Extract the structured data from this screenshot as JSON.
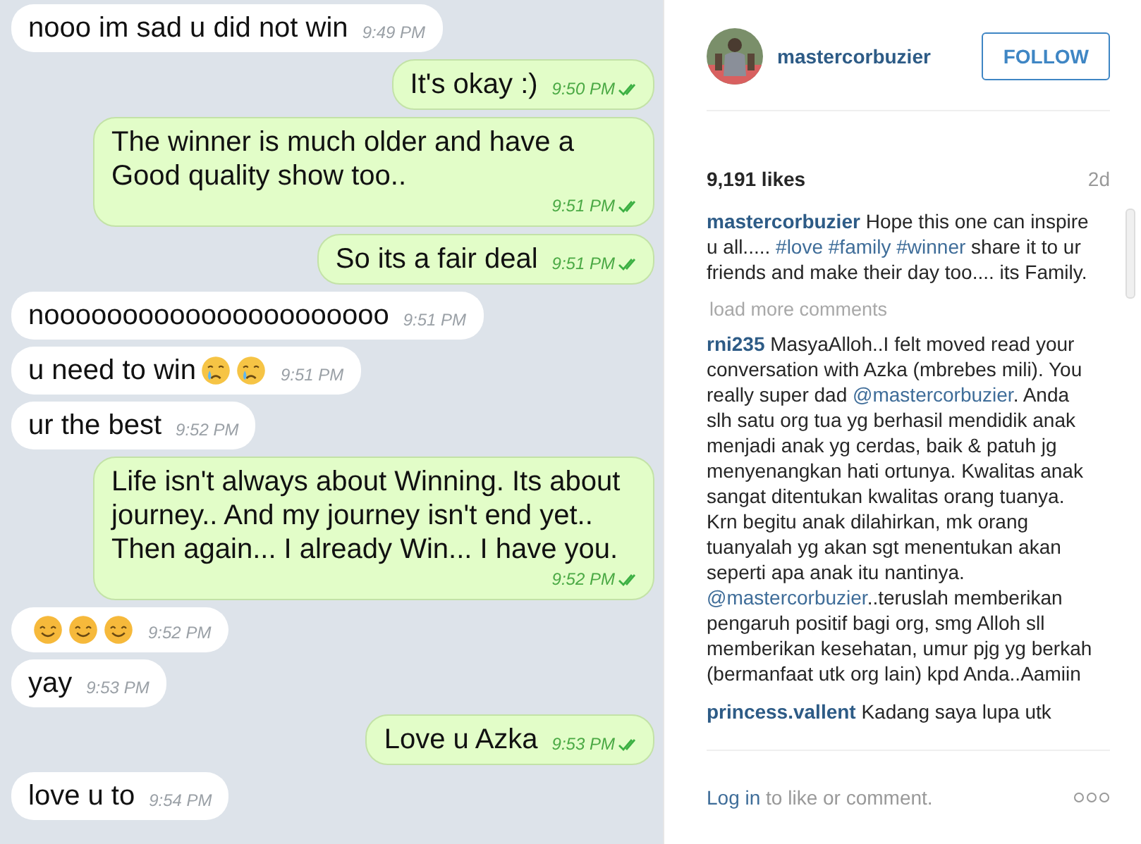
{
  "chat": {
    "messages": [
      {
        "kind": "in",
        "text": "nooo im sad u did not win",
        "time": "9:49 PM"
      },
      {
        "kind": "out",
        "text": "It's okay :)",
        "time": "9:50 PM",
        "read": true
      },
      {
        "kind": "out",
        "text": "The winner is much older and have a Good quality show too..",
        "time": "9:51 PM",
        "read": true
      },
      {
        "kind": "out",
        "text": "So its a fair deal",
        "time": "9:51 PM",
        "read": true
      },
      {
        "kind": "in",
        "text": "noooooooooooooooooooooo",
        "time": "9:51 PM"
      },
      {
        "kind": "in",
        "text": "u need to win",
        "icons": [
          {
            "kind": "crying"
          },
          {
            "kind": "crying"
          }
        ],
        "time": "9:51 PM"
      },
      {
        "kind": "in",
        "text": "ur the best",
        "time": "9:52 PM"
      },
      {
        "kind": "out",
        "text": "Life isn't always about Winning. Its about journey.. And my journey isn't end yet.. Then again... I already Win... I have you.",
        "time": "9:52 PM",
        "read": true
      },
      {
        "kind": "in",
        "icons": [
          {
            "kind": "smiling"
          },
          {
            "kind": "smiling"
          },
          {
            "kind": "smiling"
          }
        ],
        "time": "9:52 PM"
      },
      {
        "kind": "in",
        "text": "yay",
        "time": "9:53 PM"
      },
      {
        "kind": "out",
        "text": "Love u Azka",
        "time": "9:53 PM",
        "read": true
      },
      {
        "kind": "in",
        "text": "love u to",
        "time": "9:54 PM"
      }
    ]
  },
  "post": {
    "username": "mastercorbuzier",
    "follow_button": "FOLLOW",
    "likes": "9,191 likes",
    "age": "2d",
    "caption": {
      "user": "mastercorbuzier",
      "parts": [
        {
          "kind": "text",
          "text": "Hope this one can inspire u all..... "
        },
        {
          "kind": "link",
          "text": "#love #family #winner"
        },
        {
          "kind": "text",
          "text": " share it to ur friends and make their day too.... its Family."
        }
      ]
    },
    "load_more": "load more comments",
    "comments": [
      {
        "user": "rni235",
        "parts": [
          {
            "kind": "text",
            "text": "MasyaAlloh..I felt moved read your conversation with Azka (mbrebes mili). You really super dad "
          },
          {
            "kind": "link",
            "text": "@mastercorbuzier"
          },
          {
            "kind": "text",
            "text": ". Anda slh satu org tua yg berhasil mendidik anak menjadi anak yg cerdas, baik & patuh jg menyenangkan hati ortunya. Kwalitas anak sangat ditentukan kwalitas orang tuanya. Krn begitu anak dilahirkan, mk orang tuanyalah yg akan sgt menentukan akan seperti apa anak itu nantinya. "
          },
          {
            "kind": "link",
            "text": "@mastercorbuzier"
          },
          {
            "kind": "text",
            "text": "..teruslah memberikan pengaruh positif bagi org, smg Alloh sll memberikan kesehatan, umur pjg yg berkah (bermanfaat utk org lain) kpd Anda..Aamiin"
          }
        ]
      },
      {
        "user": "princess.vallent",
        "parts": [
          {
            "kind": "text",
            "text": "Kadang saya lupa utk"
          }
        ]
      }
    ],
    "login_link": "Log in",
    "login_text": " to like or comment."
  }
}
